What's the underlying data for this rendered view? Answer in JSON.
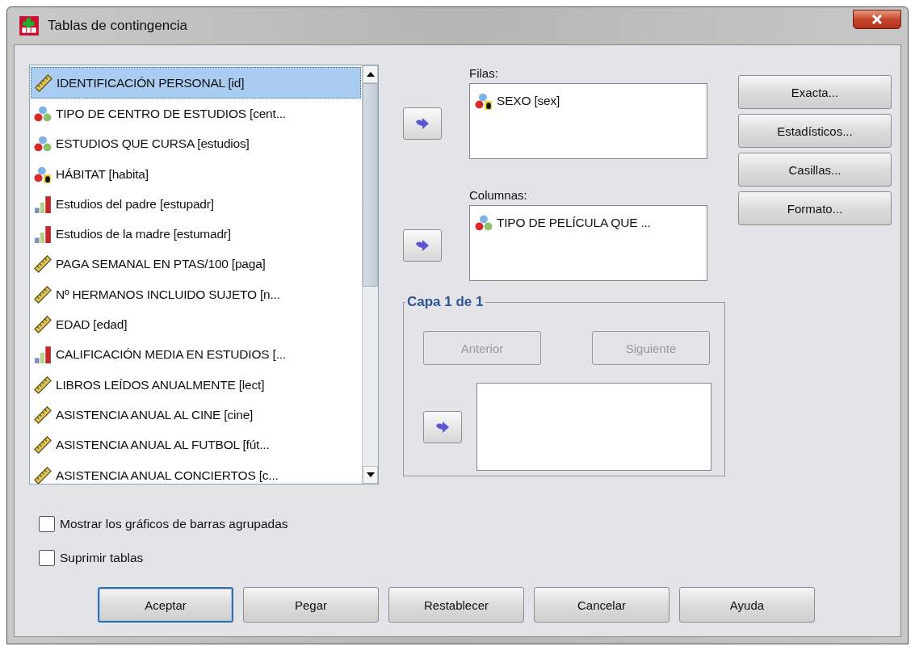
{
  "window": {
    "title": "Tablas de contingencia"
  },
  "variables": [
    {
      "name": "IDENTIFICACIÓN PERSONAL [id]",
      "kind": "scale",
      "selected": true
    },
    {
      "name": "TIPO DE CENTRO DE ESTUDIOS [cent...",
      "kind": "nominal",
      "selected": false
    },
    {
      "name": "ESTUDIOS QUE CURSA [estudios]",
      "kind": "nominal",
      "selected": false
    },
    {
      "name": "HÁBITAT [habita]",
      "kind": "nominal_string",
      "selected": false
    },
    {
      "name": "Estudios del padre [estupadr]",
      "kind": "ordinal",
      "selected": false
    },
    {
      "name": "Estudios de la madre [estumadr]",
      "kind": "ordinal",
      "selected": false
    },
    {
      "name": "PAGA SEMANAL EN PTAS/100 [paga]",
      "kind": "scale",
      "selected": false
    },
    {
      "name": "Nº HERMANOS INCLUIDO SUJETO [n...",
      "kind": "scale",
      "selected": false
    },
    {
      "name": "EDAD [edad]",
      "kind": "scale",
      "selected": false
    },
    {
      "name": "CALIFICACIÓN MEDIA EN ESTUDIOS [...",
      "kind": "ordinal",
      "selected": false
    },
    {
      "name": "LIBROS LEÍDOS ANUALMENTE [lect]",
      "kind": "scale",
      "selected": false
    },
    {
      "name": "ASISTENCIA ANUAL AL CINE [cine]",
      "kind": "scale",
      "selected": false
    },
    {
      "name": "ASISTENCIA ANUAL AL FUTBOL [fút...",
      "kind": "scale",
      "selected": false
    },
    {
      "name": "ASISTENCIA ANUAL CONCIERTOS [c...",
      "kind": "scale",
      "selected": false
    }
  ],
  "rows": {
    "label": "Filas:",
    "items": [
      {
        "name": "SEXO [sex]",
        "kind": "nominal_string"
      }
    ]
  },
  "columns": {
    "label": "Columnas:",
    "items": [
      {
        "name": "TIPO DE PELÍCULA QUE ...",
        "kind": "nominal"
      }
    ]
  },
  "layer": {
    "title": "Capa 1 de 1",
    "buttons": [
      {
        "label": "Anterior",
        "disabled": true
      },
      {
        "label": "Siguiente",
        "disabled": true
      }
    ]
  },
  "side_buttons": [
    "Exacta...",
    "Estadísticos...",
    "Casillas...",
    "Formato..."
  ],
  "options": [
    {
      "label": "Mostrar los gráficos de barras agrupadas",
      "checked": false
    },
    {
      "label": "Suprimir tablas",
      "checked": false
    }
  ],
  "buttons": [
    {
      "label": "Aceptar",
      "default": true
    },
    {
      "label": "Pegar",
      "default": false
    },
    {
      "label": "Restablecer",
      "default": false
    },
    {
      "label": "Cancelar",
      "default": false
    },
    {
      "label": "Ayuda",
      "default": false
    }
  ]
}
